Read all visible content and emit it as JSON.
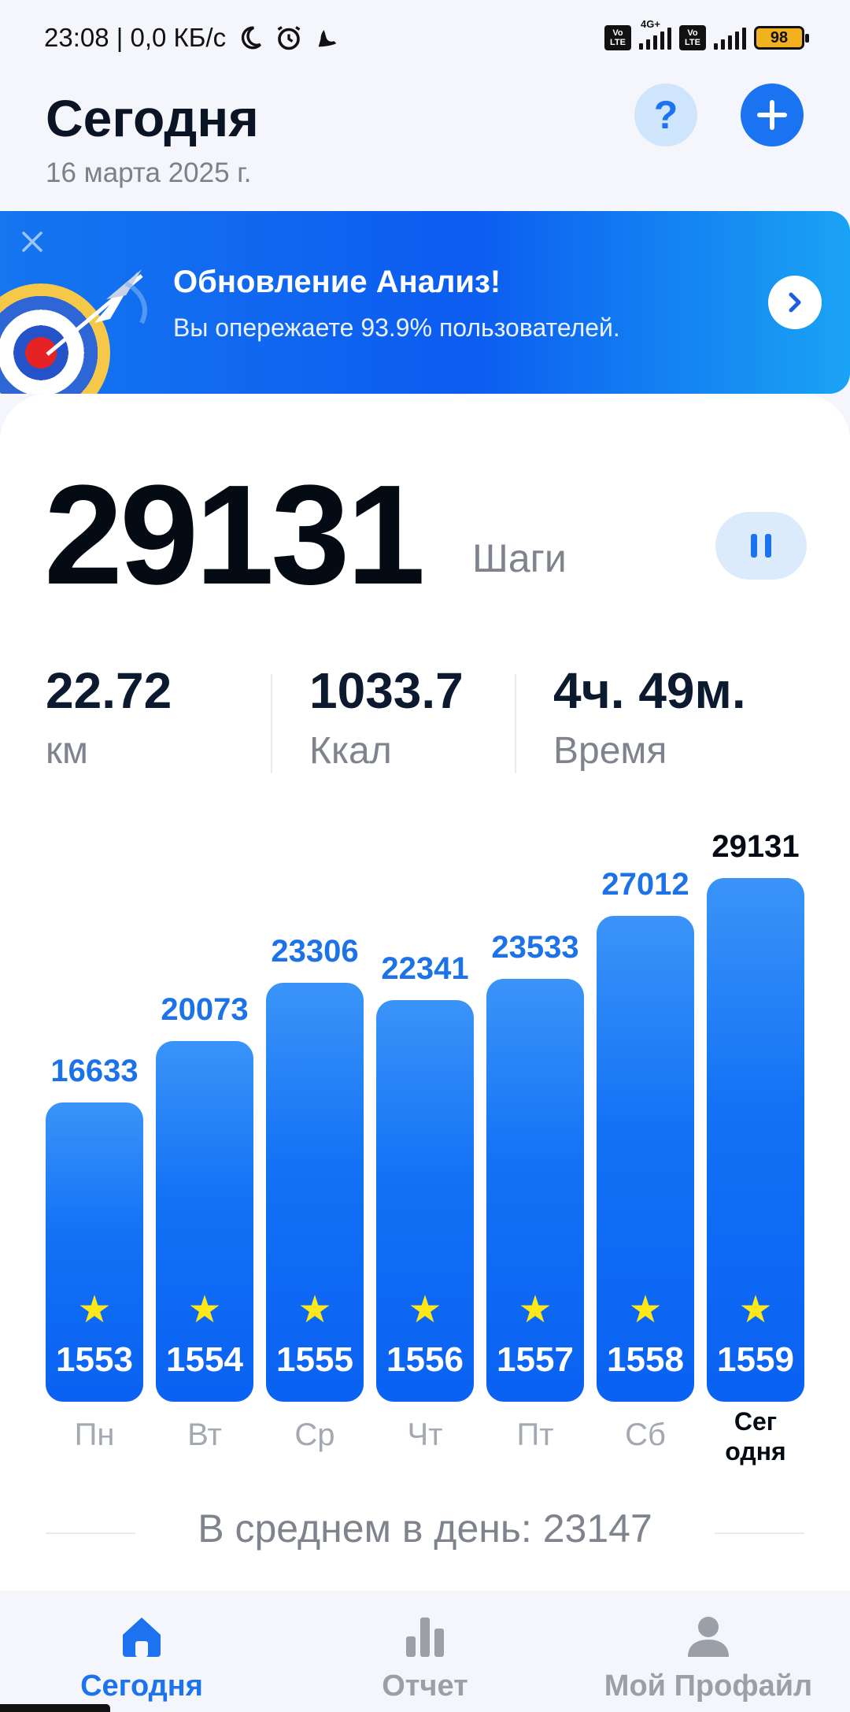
{
  "status_bar": {
    "time_speed": "23:08 | 0,0 КБ/с",
    "network": "4G+",
    "volte": "Vo LTE",
    "battery": "98"
  },
  "header": {
    "title": "Сегодня",
    "date": "16 марта 2025 г.",
    "help_label": "?"
  },
  "banner": {
    "title": "Обновление Анализ!",
    "subtitle": "Вы опережаете 93.9% пользователей."
  },
  "summary": {
    "steps": "29131",
    "steps_unit": "Шаги",
    "distance": {
      "value": "22.72",
      "label": "км"
    },
    "calories": {
      "value": "1033.7",
      "label": "Ккал"
    },
    "time": {
      "value": "4ч. 49м.",
      "label": "Время"
    }
  },
  "chart_data": {
    "type": "bar",
    "categories": [
      "Пн",
      "Вт",
      "Ср",
      "Чт",
      "Пт",
      "Сб",
      "Сег одня"
    ],
    "values": [
      16633,
      20073,
      23306,
      22341,
      23533,
      27012,
      29131
    ],
    "bar_numbers": [
      "1553",
      "1554",
      "1555",
      "1556",
      "1557",
      "1558",
      "1559"
    ],
    "star": "★",
    "highlight_index": 6,
    "colors": {
      "bar": "#1271f5",
      "value_label": "#1d72e8",
      "today_label": "#050b15",
      "star": "#ffe818"
    }
  },
  "average": "В среднем в день: 23147",
  "nav": {
    "items": [
      {
        "label": "Сегодня",
        "icon": "home-icon",
        "active": true
      },
      {
        "label": "Отчет",
        "icon": "bar-chart-icon",
        "active": false
      },
      {
        "label": "Мой Профайл",
        "icon": "user-icon",
        "active": false
      }
    ]
  },
  "colors": {
    "accent": "#1a73f0",
    "banner_start": "#1576f0",
    "banner_end": "#1aa3f4"
  }
}
